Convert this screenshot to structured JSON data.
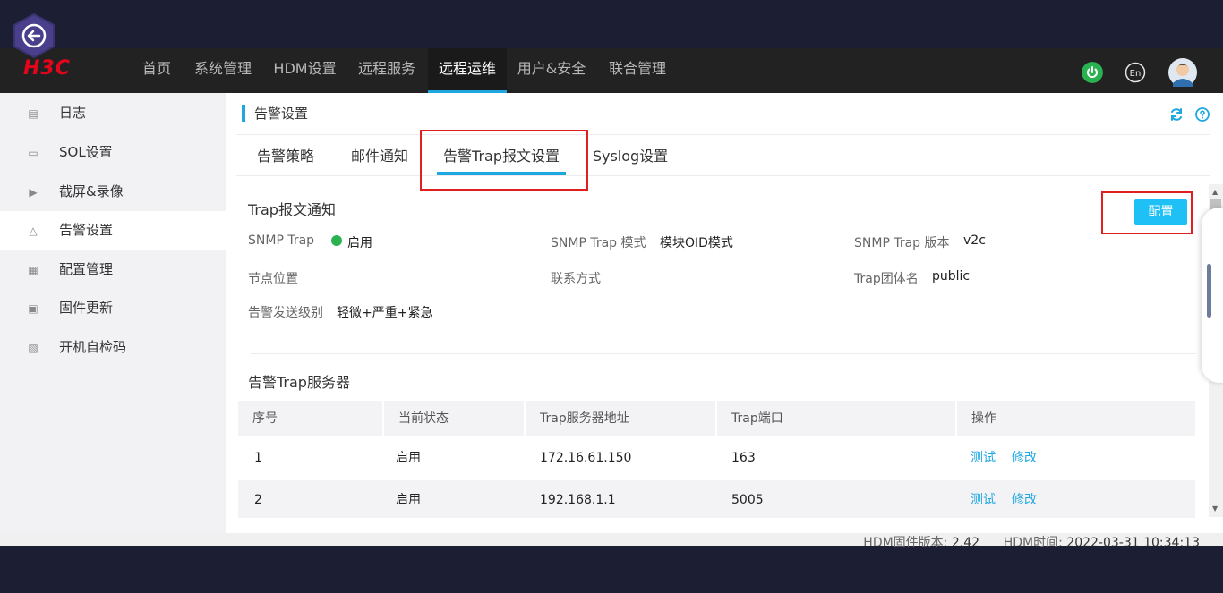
{
  "brand": {
    "logo_text": "H3C",
    "logo_color": "#e3051b",
    "accent": "#1ea7e1"
  },
  "top_nav": {
    "items": [
      "首页",
      "系统管理",
      "HDM设置",
      "远程服务",
      "远程运维",
      "用户&安全",
      "联合管理"
    ],
    "active": "远程运维",
    "right_icons": [
      "power-icon",
      "language-icon",
      "user-avatar"
    ],
    "lang_label": "En"
  },
  "sidebar": {
    "items": [
      {
        "label": "日志",
        "icon": "log-icon"
      },
      {
        "label": "SOL设置",
        "icon": "sol-icon"
      },
      {
        "label": "截屏&录像",
        "icon": "video-icon"
      },
      {
        "label": "告警设置",
        "icon": "alarm-icon"
      },
      {
        "label": "配置管理",
        "icon": "config-icon"
      },
      {
        "label": "固件更新",
        "icon": "firmware-icon"
      },
      {
        "label": "开机自检码",
        "icon": "post-code-icon"
      }
    ],
    "active": "告警设置"
  },
  "page": {
    "title": "告警设置",
    "tabs": [
      "告警策略",
      "邮件通知",
      "告警Trap报文设置",
      "Syslog设置"
    ],
    "active_tab": "告警Trap报文设置"
  },
  "trap_notify": {
    "section_title": "Trap报文通知",
    "config_button": "配置",
    "snmp_trap_label": "SNMP Trap",
    "snmp_trap_value": "启用",
    "snmp_mode_label": "SNMP Trap 模式",
    "snmp_mode_value": "模块OID模式",
    "snmp_version_label": "SNMP Trap 版本",
    "snmp_version_value": "v2c",
    "node_location_label": "节点位置",
    "contact_label": "联系方式",
    "community_label": "Trap团体名",
    "community_value": "public",
    "alert_level_label": "告警发送级别",
    "alert_level_value": "轻微+严重+紧急"
  },
  "trap_servers": {
    "section_title": "告警Trap服务器",
    "columns": [
      "序号",
      "当前状态",
      "Trap服务器地址",
      "Trap端口",
      "操作"
    ],
    "rows": [
      {
        "index": "1",
        "status": "启用",
        "address": "172.16.61.150",
        "port": "163",
        "actions": [
          "测试",
          "修改"
        ]
      },
      {
        "index": "2",
        "status": "启用",
        "address": "192.168.1.1",
        "port": "5005",
        "actions": [
          "测试",
          "修改"
        ]
      }
    ]
  },
  "footer": {
    "fw_label": "HDM固件版本:",
    "fw_value": "2.42",
    "time_label": "HDM时间:",
    "time_value": "2022-03-31 10:34:13"
  }
}
